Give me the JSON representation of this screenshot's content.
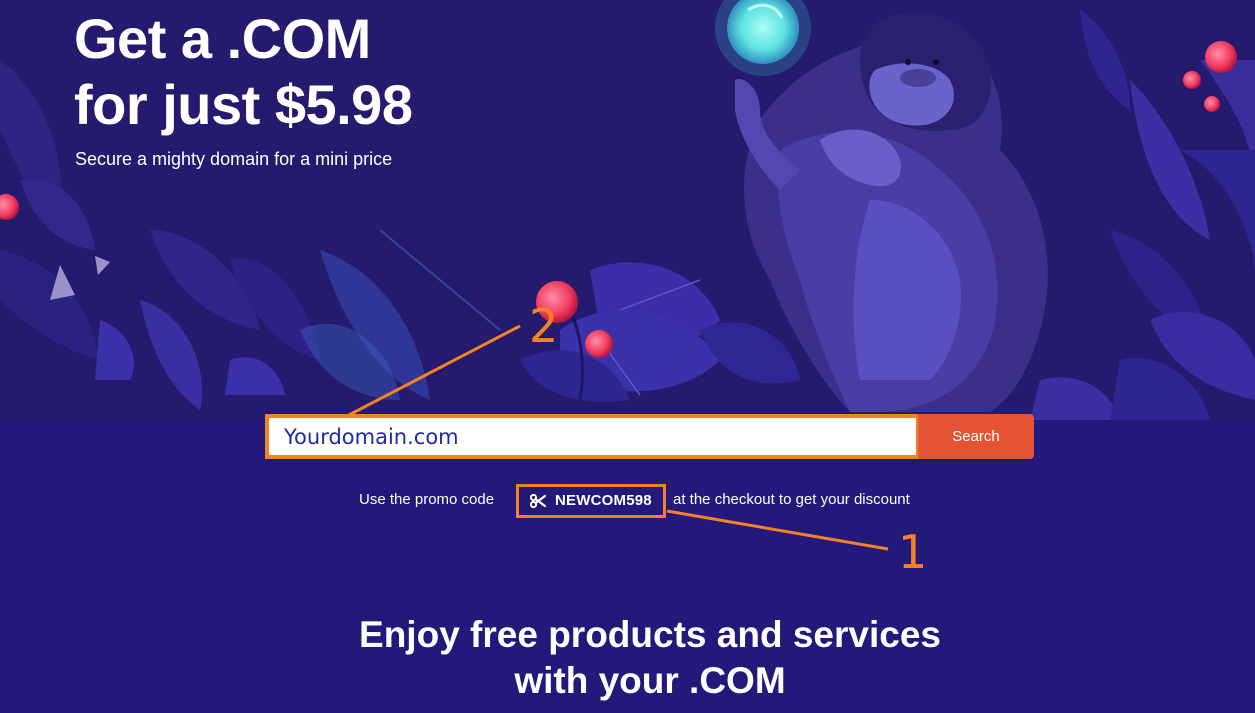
{
  "hero": {
    "title_line1": "Get a .COM",
    "title_line2": "for just $5.98",
    "subtitle": "Secure a mighty domain for a mini price"
  },
  "search": {
    "value": "Yourdomain.com",
    "button_label": "Search"
  },
  "promo": {
    "text_before": "Use the promo code",
    "code": "NEWCOM598",
    "text_after": "at the checkout to get your discount",
    "icon": "scissors-icon"
  },
  "annotations": {
    "marker_1": "1",
    "marker_2": "2"
  },
  "section": {
    "title_line1": "Enjoy free products and services",
    "title_line2": "with your .COM"
  },
  "colors": {
    "background": "#221a6b",
    "accent_orange": "#f48126",
    "search_button": "#e55335",
    "input_text": "#1f2ba8"
  }
}
